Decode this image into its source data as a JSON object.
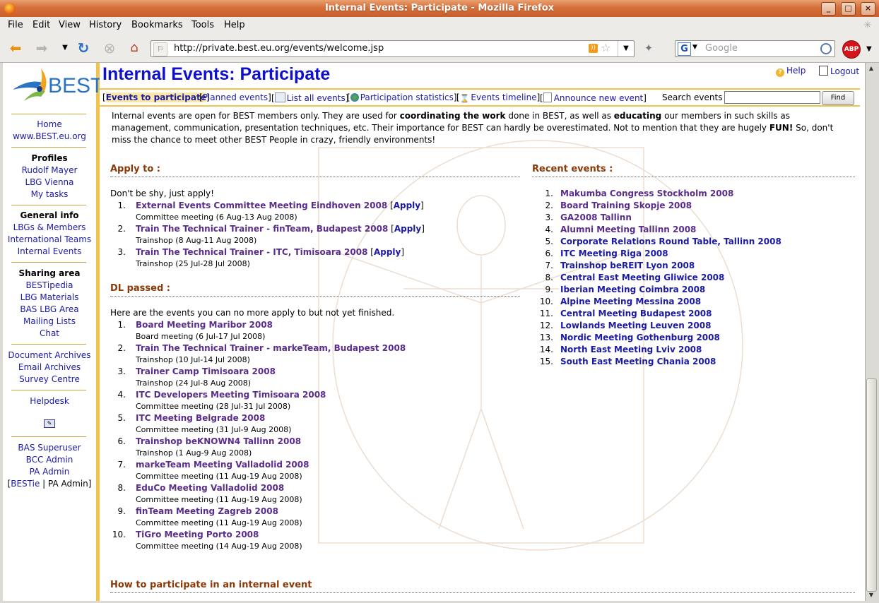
{
  "window": {
    "title": "Internal Events: Participate - Mozilla Firefox"
  },
  "menubar": [
    {
      "label": "File"
    },
    {
      "label": "Edit"
    },
    {
      "label": "View"
    },
    {
      "label": "History"
    },
    {
      "label": "Bookmarks"
    },
    {
      "label": "Tools"
    },
    {
      "label": "Help"
    }
  ],
  "navbar": {
    "url": "http://private.best.eu.org/events/welcome.jsp",
    "search_placeholder": "Google",
    "abp_label": "ABP"
  },
  "sidebar": {
    "logo_text": "BEST",
    "links_top": [
      "Home",
      "www.BEST.eu.org"
    ],
    "profiles": {
      "heading": "Profiles",
      "items": [
        "Rudolf Mayer",
        "LBG Vienna",
        "My tasks"
      ]
    },
    "general": {
      "heading": "General info",
      "items": [
        "LBGs & Members",
        "International Teams",
        "Internal Events"
      ]
    },
    "sharing": {
      "heading": "Sharing area",
      "items": [
        "BESTipedia",
        "LBG Materials",
        "BAS LBG Area",
        "Mailing Lists",
        "Chat"
      ]
    },
    "archives": [
      "Document Archives",
      "Email Archives",
      "Survey Centre"
    ],
    "helpdesk": "Helpdesk",
    "admin": [
      "BAS Superuser",
      "BCC Admin",
      "PA Admin"
    ],
    "role_switch": {
      "link": "BESTie",
      "current": "PA Admin"
    }
  },
  "page": {
    "title": "Internal Events: Participate",
    "help": "Help",
    "logout": "Logout",
    "tabs": {
      "events_to_participate": "Events to participate",
      "planned": "Planned events",
      "list_all": "List all events",
      "stats": "Participation statistics",
      "timeline": "Events timeline",
      "announce": "Announce new event"
    },
    "search_label": "Search events",
    "find_button": "Find",
    "intro": {
      "p1": "Internal events are open for BEST members only. They are used for ",
      "b1": "coordinating the work",
      "p2": " done in BEST, as well as ",
      "b2": "educating",
      "p3": " our members in such skills as management, communication, presentation techniques, etc. Their importance for BEST can hardly be overestimated. Not to mention that they are hugely ",
      "b3": "FUN!",
      "p4": " So, don't miss the chance to meet other BEST People in crazy, friendly environments!"
    },
    "apply": {
      "heading": "Apply to :",
      "lead": "Don't be shy, just apply!",
      "apply_label": "Apply",
      "items": [
        {
          "num": "1.",
          "name": "External Events Committee Meeting Eindhoven 2008",
          "sub": "Committee meeting (6 Aug-13 Aug 2008)"
        },
        {
          "num": "2.",
          "name": "Train The Technical Trainer - finTeam, Budapest 2008",
          "sub": "Trainshop (8 Aug-11 Aug 2008)"
        },
        {
          "num": "3.",
          "name": "Train The Technical Trainer - ITC, Timisoara 2008",
          "sub": "Trainshop (25 Jul-28 Jul 2008)"
        }
      ]
    },
    "dl_passed": {
      "heading": "DL passed :",
      "lead": "Here are the events you can no more apply to but not yet finished.",
      "items": [
        {
          "num": "1.",
          "name": "Board Meeting Maribor 2008",
          "sub": "Board meeting (6 Jul-17 Jul 2008)"
        },
        {
          "num": "2.",
          "name": "Train The Technical Trainer - markeTeam, Budapest 2008",
          "sub": "Trainshop (10 Jul-14 Jul 2008)"
        },
        {
          "num": "3.",
          "name": "Trainer Camp Timisoara 2008",
          "sub": "Trainshop (24 Jul-8 Aug 2008)"
        },
        {
          "num": "4.",
          "name": "ITC Developers Meeting Timisoara 2008",
          "sub": "Committee meeting (28 Jul-31 Jul 2008)"
        },
        {
          "num": "5.",
          "name": "ITC Meeting Belgrade 2008",
          "sub": "Committee meeting (31 Jul-9 Aug 2008)"
        },
        {
          "num": "6.",
          "name": "Trainshop beKNOWN4 Tallinn 2008",
          "sub": "Trainshop (1 Aug-9 Aug 2008)"
        },
        {
          "num": "7.",
          "name": "markeTeam Meeting Valladolid 2008",
          "sub": "Committee meeting (11 Aug-19 Aug 2008)"
        },
        {
          "num": "8.",
          "name": "EduCo Meeting Valladolid 2008",
          "sub": "Committee meeting (11 Aug-19 Aug 2008)"
        },
        {
          "num": "9.",
          "name": "finTeam Meeting Zagreb 2008",
          "sub": "Committee meeting (11 Aug-19 Aug 2008)"
        },
        {
          "num": "10.",
          "name": "TiGro Meeting Porto 2008",
          "sub": "Committee meeting (14 Aug-19 Aug 2008)"
        }
      ]
    },
    "recent": {
      "heading": "Recent events :",
      "items": [
        {
          "num": "1.",
          "name": "Makumba Congress Stockholm 2008",
          "visited": true
        },
        {
          "num": "2.",
          "name": "Board Training Skopje 2008",
          "visited": true
        },
        {
          "num": "3.",
          "name": "GA2008 Tallinn",
          "visited": true
        },
        {
          "num": "4.",
          "name": "Alumni Meeting Tallinn 2008",
          "visited": true
        },
        {
          "num": "5.",
          "name": "Corporate Relations Round Table, Tallinn 2008",
          "visited": false
        },
        {
          "num": "6.",
          "name": "ITC Meeting Riga 2008",
          "visited": false
        },
        {
          "num": "7.",
          "name": "Trainshop beREIT Lyon 2008",
          "visited": false
        },
        {
          "num": "8.",
          "name": "Central East Meeting Gliwice 2008",
          "visited": false
        },
        {
          "num": "9.",
          "name": "Iberian Meeting Coimbra 2008",
          "visited": false
        },
        {
          "num": "10.",
          "name": "Alpine Meeting Messina 2008",
          "visited": false
        },
        {
          "num": "11.",
          "name": "Central Meeting Budapest 2008",
          "visited": false
        },
        {
          "num": "12.",
          "name": "Lowlands Meeting Leuven 2008",
          "visited": false
        },
        {
          "num": "13.",
          "name": "Nordic Meeting Gothenburg 2008",
          "visited": false
        },
        {
          "num": "14.",
          "name": "North East Meeting Lviv 2008",
          "visited": false
        },
        {
          "num": "15.",
          "name": "South East Meeting Chania 2008",
          "visited": false
        }
      ]
    },
    "how_to": {
      "heading": "How to participate in an internal event"
    }
  },
  "colors": {
    "title_blue": "#1010cc",
    "link": "#1a1aa6",
    "visited": "#5a2d8c",
    "section_brown": "#8a3a08",
    "accent_yellow": "#f2c34c"
  }
}
